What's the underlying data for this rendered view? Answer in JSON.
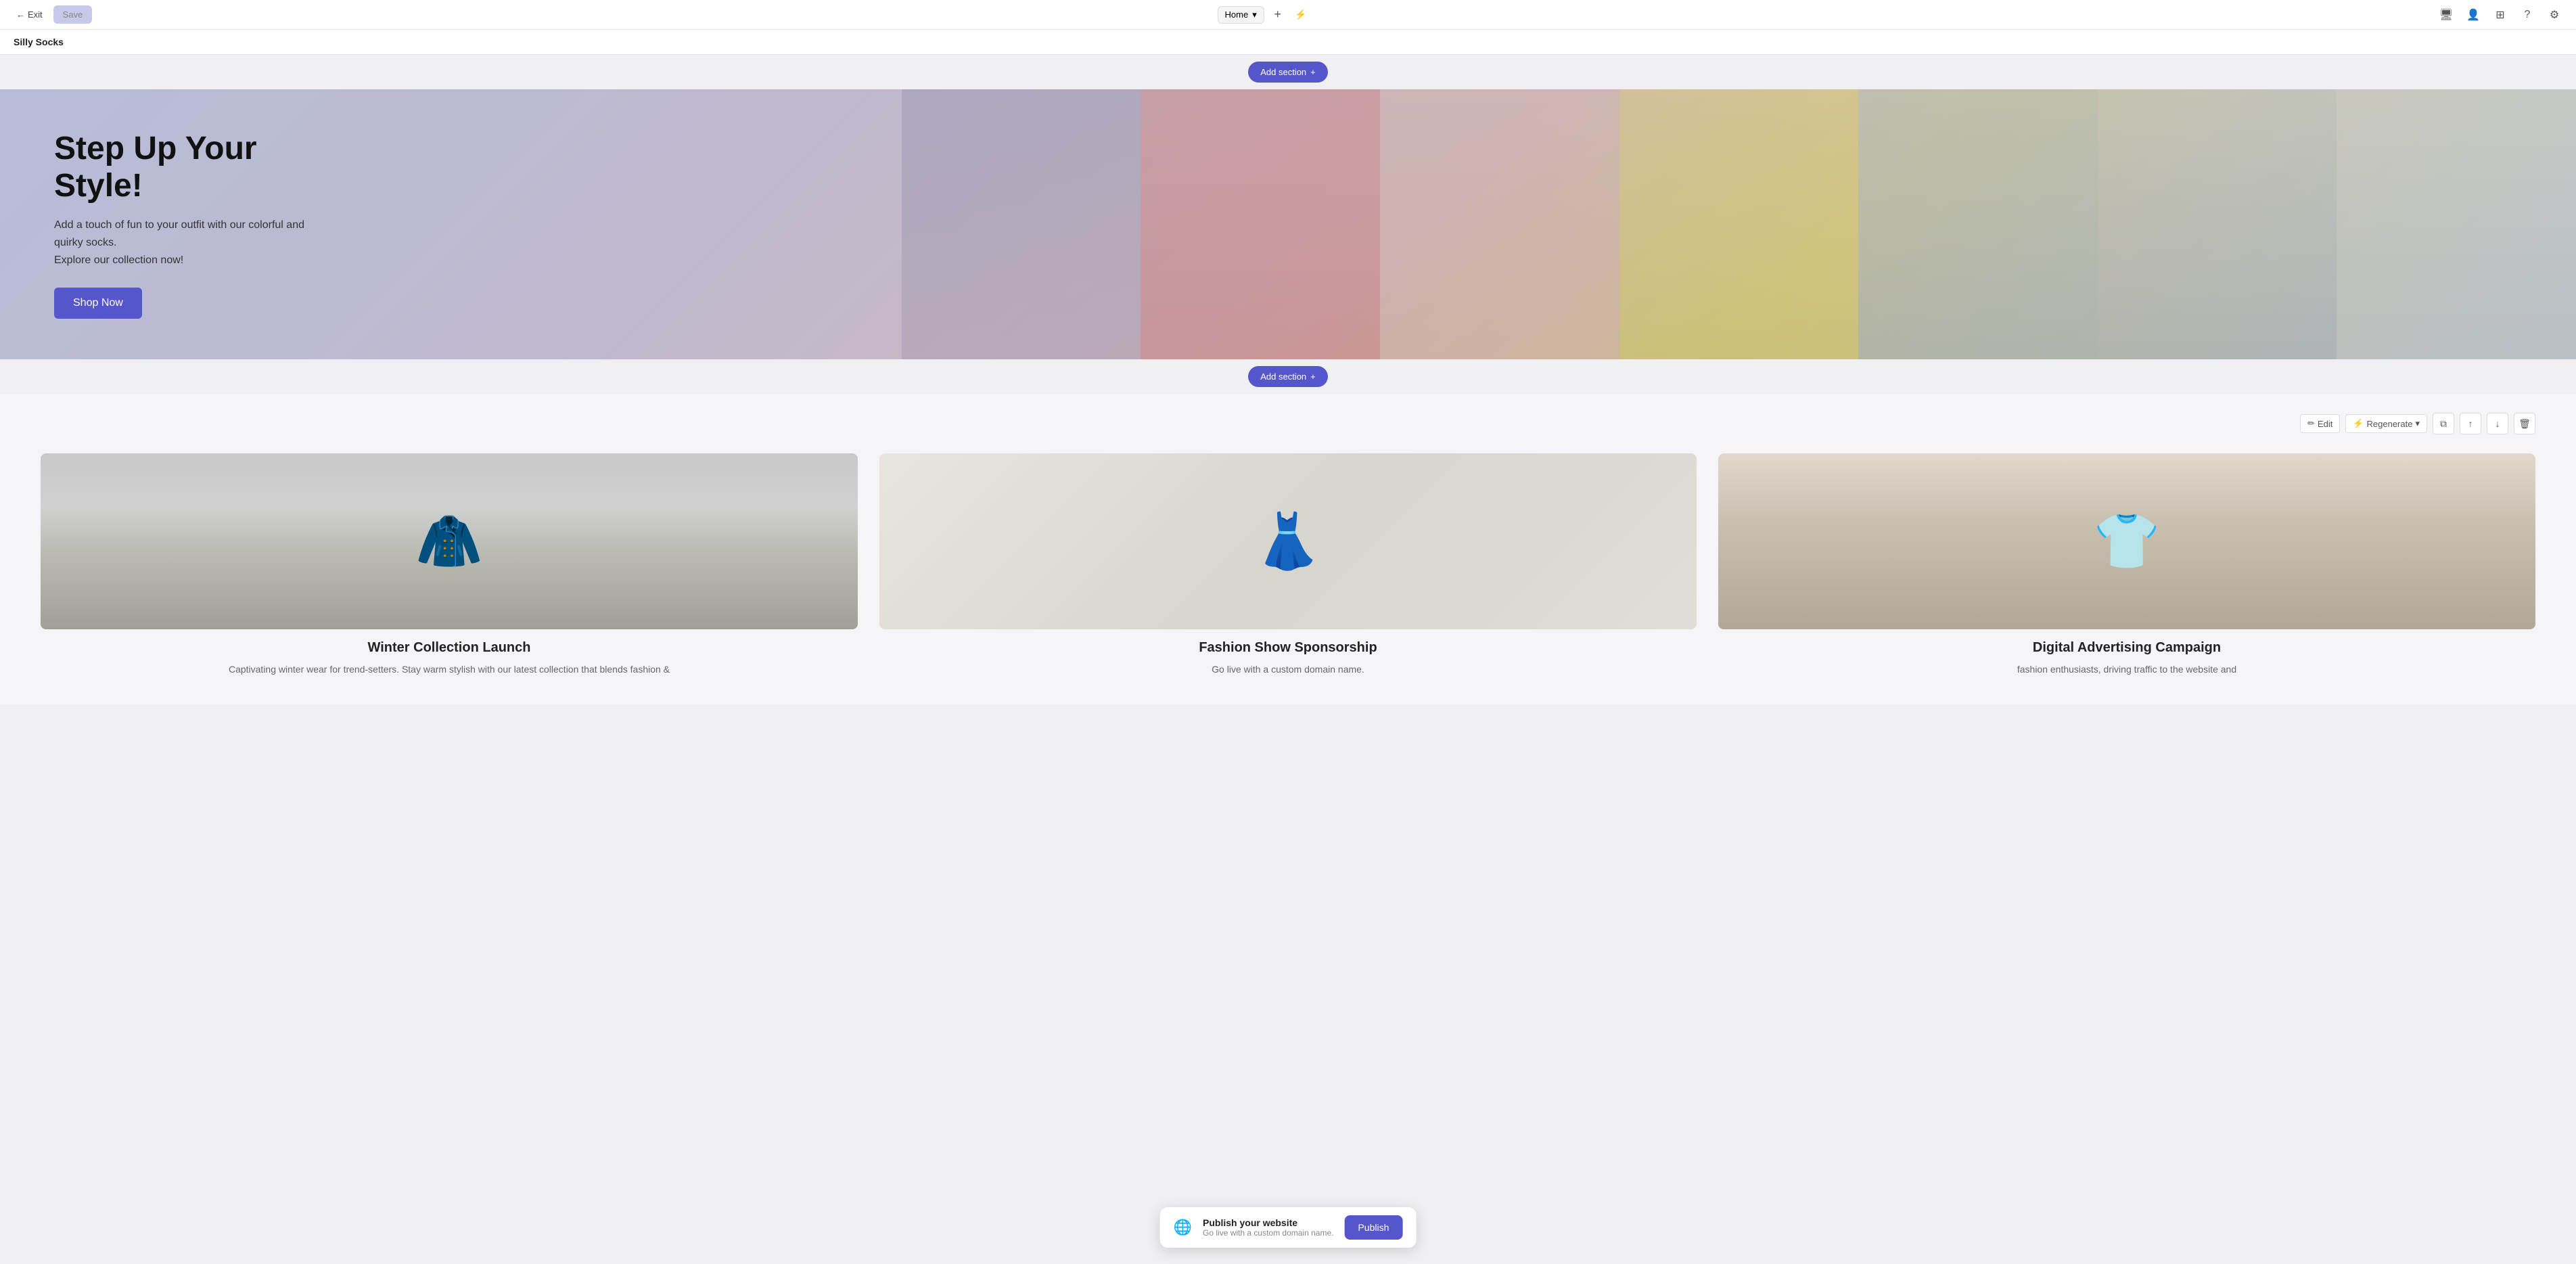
{
  "topbar": {
    "exit_label": "Exit",
    "save_label": "Save",
    "page_name": "Home",
    "chevron": "▾",
    "add_icon": "+",
    "lightning_icon": "⚡"
  },
  "site": {
    "title": "Silly Socks"
  },
  "hero": {
    "add_section_top": "Add section",
    "add_section_bottom": "Add section",
    "title": "Step Up Your Style!",
    "description_line1": "Add a touch of fun to your outfit with our colorful and quirky socks.",
    "description_line2": "Explore our collection now!",
    "cta_label": "Shop Now"
  },
  "products_section": {
    "edit_label": "Edit",
    "regenerate_label": "Regenerate",
    "products": [
      {
        "title": "Winter Collection Launch",
        "description": "Captivating winter wear for trend-setters. Stay warm stylish with our latest collection that blends fashion &",
        "image_type": "clothes-rack",
        "image_emoji": "🧥"
      },
      {
        "title": "Fashion Show Sponsorship",
        "description": "Go live with a custom domain name.",
        "image_type": "hangers",
        "image_emoji": "👗"
      },
      {
        "title": "Digital Advertising Campaign",
        "description": "fashion enthusiasts, driving traffic to the website and",
        "image_type": "woman-tshirt",
        "image_emoji": "👕"
      }
    ]
  },
  "publish": {
    "icon": "🌐",
    "title": "Publish your website",
    "subtitle": "Go live with a custom domain name.",
    "button_label": "Publish"
  },
  "icons": {
    "back_arrow": "←",
    "chevron_down": "▾",
    "plus": "+",
    "lightning": "⚡",
    "desktop": "🖥",
    "users": "👤",
    "grid": "⊞",
    "help": "?",
    "settings": "⚙",
    "edit_pencil": "✏",
    "regenerate": "⚡",
    "copy": "⧉",
    "arrow_up": "↑",
    "arrow_down": "↓",
    "trash": "🗑"
  }
}
